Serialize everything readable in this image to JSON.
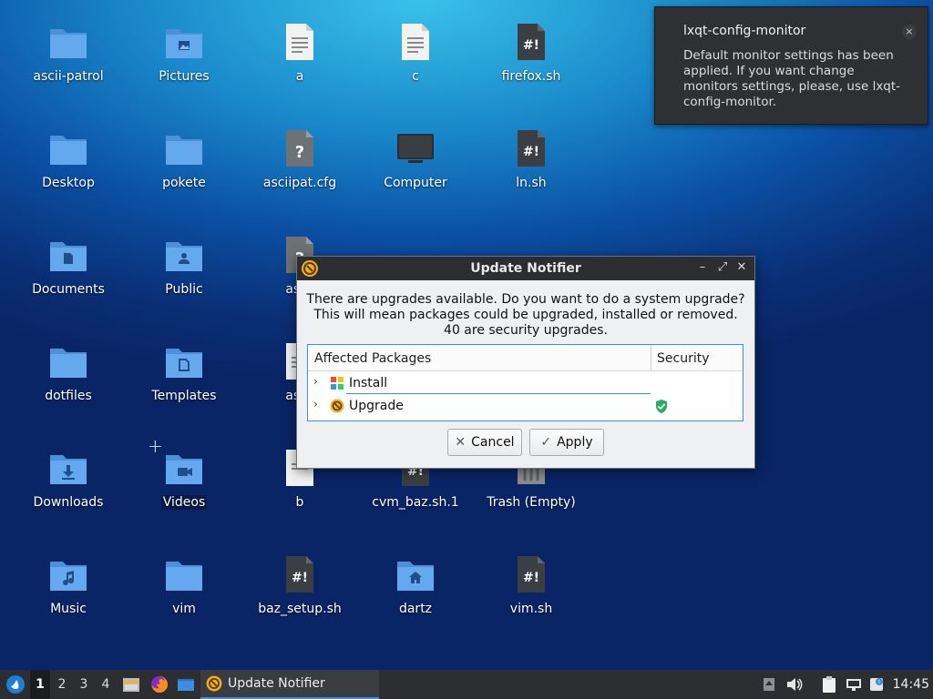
{
  "desktop_icons": [
    {
      "label": "ascii-patrol",
      "type": "folder"
    },
    {
      "label": "Pictures",
      "type": "folder-pictures"
    },
    {
      "label": "a",
      "type": "text"
    },
    {
      "label": "c",
      "type": "text"
    },
    {
      "label": "firefox.sh",
      "type": "script"
    },
    {
      "label": "Desktop",
      "type": "folder"
    },
    {
      "label": "pokete",
      "type": "folder"
    },
    {
      "label": "asciipat.cfg",
      "type": "unknown"
    },
    {
      "label": "Computer",
      "type": "computer"
    },
    {
      "label": "ln.sh",
      "type": "script"
    },
    {
      "label": "Documents",
      "type": "folder-documents"
    },
    {
      "label": "Public",
      "type": "folder-public"
    },
    {
      "label": "ascii",
      "type": "unknown"
    },
    {
      "label": "dotfiles",
      "type": "folder"
    },
    {
      "label": "Templates",
      "type": "folder-templates"
    },
    {
      "label": "ascii",
      "type": "text"
    },
    {
      "label": "Downloads",
      "type": "folder-downloads"
    },
    {
      "label": "Videos",
      "type": "folder-videos"
    },
    {
      "label": "b",
      "type": "text"
    },
    {
      "label": "cvm_baz.sh.1",
      "type": "script"
    },
    {
      "label": "Trash (Empty)",
      "type": "trash"
    },
    {
      "label": "Music",
      "type": "folder-music"
    },
    {
      "label": "vim",
      "type": "folder"
    },
    {
      "label": "baz_setup.sh",
      "type": "script"
    },
    {
      "label": "dartz",
      "type": "folder-home"
    },
    {
      "label": "vim.sh",
      "type": "script"
    }
  ],
  "notification": {
    "title": "lxqt-config-monitor",
    "body": "Default monitor settings has been applied. If you want change monitors settings, please, use lxqt-config-monitor.",
    "close_icon": "×"
  },
  "dialog": {
    "title": "Update Notifier",
    "message_lines": [
      "There are upgrades available. Do you want to do a system upgrade?",
      "This will mean packages could be upgraded, installed or removed.",
      "40 are security upgrades."
    ],
    "columns": {
      "packages": "Affected Packages",
      "security": "Security"
    },
    "rows": [
      {
        "label": "Install",
        "icon": "install-icon"
      },
      {
        "label": "Upgrade",
        "icon": "upgrade-icon",
        "security": "shield-check-icon"
      }
    ],
    "cancel_label": "Cancel",
    "apply_label": "Apply",
    "window_buttons": {
      "minimize": "–",
      "maximize": "⤢",
      "close": "✕"
    }
  },
  "taskbar": {
    "workspaces": [
      "1",
      "2",
      "3",
      "4"
    ],
    "active_workspace": "1",
    "task_label": "Update Notifier",
    "clock": "14:45"
  },
  "colors": {
    "accent": "#3d8ee0",
    "folder": "#5aa0ea",
    "titlebar": "#2b2d30",
    "taskbar": "#2c2e31"
  }
}
